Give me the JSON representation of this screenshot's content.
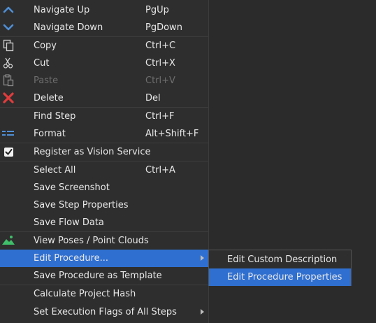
{
  "menu": {
    "items": [
      {
        "label": "Navigate Up",
        "shortcut": "PgUp",
        "icon": "chevron-up-icon"
      },
      {
        "label": "Navigate Down",
        "shortcut": "PgDown",
        "icon": "chevron-down-icon"
      },
      {
        "label": "Copy",
        "shortcut": "Ctrl+C",
        "icon": "copy-icon"
      },
      {
        "label": "Cut",
        "shortcut": "Ctrl+X",
        "icon": "scissors-icon"
      },
      {
        "label": "Paste",
        "shortcut": "Ctrl+V",
        "icon": "paste-icon",
        "disabled": true
      },
      {
        "label": "Delete",
        "shortcut": "Del",
        "icon": "delete-x-icon"
      },
      {
        "label": "Find Step",
        "shortcut": "Ctrl+F"
      },
      {
        "label": "Format",
        "shortcut": "Alt+Shift+F",
        "icon": "format-icon"
      },
      {
        "label": "Register as Vision Service",
        "icon": "checkbox-checked-icon"
      },
      {
        "label": "Select All",
        "shortcut": "Ctrl+A"
      },
      {
        "label": "Save Screenshot"
      },
      {
        "label": "Save Step Properties"
      },
      {
        "label": "Save Flow Data"
      },
      {
        "label": "View Poses / Point Clouds",
        "icon": "landscape-image-icon"
      },
      {
        "label": "Edit Procedure...",
        "submenu": true,
        "highlighted": true
      },
      {
        "label": "Save Procedure as Template"
      },
      {
        "label": "Calculate Project Hash"
      },
      {
        "label": "Set Execution Flags of All Steps",
        "submenu": true
      }
    ]
  },
  "submenu": {
    "items": [
      {
        "label": "Edit Custom Description"
      },
      {
        "label": "Edit Procedure Properties",
        "highlighted": true
      }
    ]
  },
  "colors": {
    "menu_bg": "#2e2e2e",
    "highlight": "#2f6fd0",
    "text": "#e8e8e8",
    "disabled_text": "#6e6e6e",
    "icon_blue": "#4f8fd6",
    "delete_red": "#e03c3c",
    "icon_green": "#3fbf6a"
  }
}
